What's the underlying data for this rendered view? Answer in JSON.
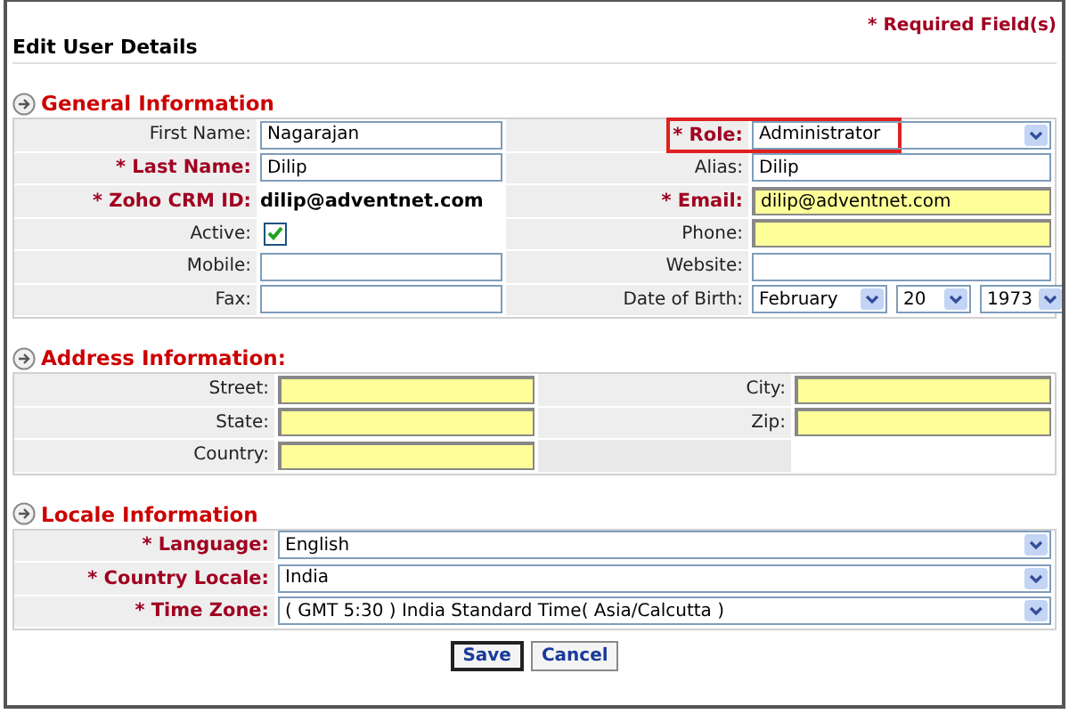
{
  "header": {
    "title": "Edit User Details",
    "required_note": "* Required Field(s)"
  },
  "sections": [
    {
      "title": "General Information",
      "kind": "two_column",
      "rows": [
        [
          {
            "label": "First Name:",
            "required": false,
            "kind": "text",
            "value": "Nagarajan"
          },
          {
            "label": "* Role:",
            "required": true,
            "kind": "select",
            "value": "Administrator",
            "flagged": true
          }
        ],
        [
          {
            "label": "* Last Name:",
            "required": true,
            "kind": "text",
            "value": "Dilip"
          },
          {
            "label": "Alias:",
            "required": false,
            "kind": "text",
            "value": "Dilip"
          }
        ],
        [
          {
            "label": "* Zoho CRM ID:",
            "required": true,
            "kind": "static",
            "value": "dilip@adventnet.com"
          },
          {
            "label": "* Email:",
            "required": true,
            "kind": "text",
            "value": "dilip@adventnet.com",
            "highlighted": true
          }
        ],
        [
          {
            "label": "Active:",
            "required": false,
            "kind": "checkbox",
            "checked": true
          },
          {
            "label": "Phone:",
            "required": false,
            "kind": "text",
            "highlighted": true
          }
        ],
        [
          {
            "label": "Mobile:",
            "required": false,
            "kind": "text"
          },
          {
            "label": "Website:",
            "required": false,
            "kind": "text"
          }
        ],
        [
          {
            "label": "Fax:",
            "required": false,
            "kind": "text"
          },
          {
            "label": "Date of Birth:",
            "required": false,
            "kind": "date",
            "parts": [
              {
                "value": "February"
              },
              {
                "value": "20"
              },
              {
                "value": "1973"
              }
            ]
          }
        ]
      ]
    },
    {
      "title": "Address Information:",
      "kind": "address",
      "rows": [
        [
          {
            "label": "Street:",
            "required": false,
            "kind": "text",
            "highlighted": true
          },
          {
            "label": "City:",
            "required": false,
            "kind": "text",
            "highlighted": true
          }
        ],
        [
          {
            "label": "State:",
            "required": false,
            "kind": "text",
            "highlighted": true
          },
          {
            "label": "Zip:",
            "required": false,
            "kind": "text",
            "highlighted": true
          }
        ],
        [
          {
            "label": "Country:",
            "required": false,
            "kind": "text",
            "highlighted": true
          }
        ]
      ]
    },
    {
      "title": "Locale Information",
      "kind": "single_column",
      "rows": [
        [
          {
            "label": "* Language:",
            "required": true,
            "kind": "select",
            "value": "English"
          }
        ],
        [
          {
            "label": "* Country Locale:",
            "required": true,
            "kind": "select",
            "value": "India"
          }
        ],
        [
          {
            "label": "* Time Zone:",
            "required": true,
            "kind": "select",
            "value": "( GMT 5:30 ) India Standard Time( Asia/Calcutta )"
          }
        ]
      ]
    }
  ],
  "buttons": [
    {
      "label": "Save",
      "default": true
    },
    {
      "label": "Cancel",
      "default": false
    }
  ]
}
